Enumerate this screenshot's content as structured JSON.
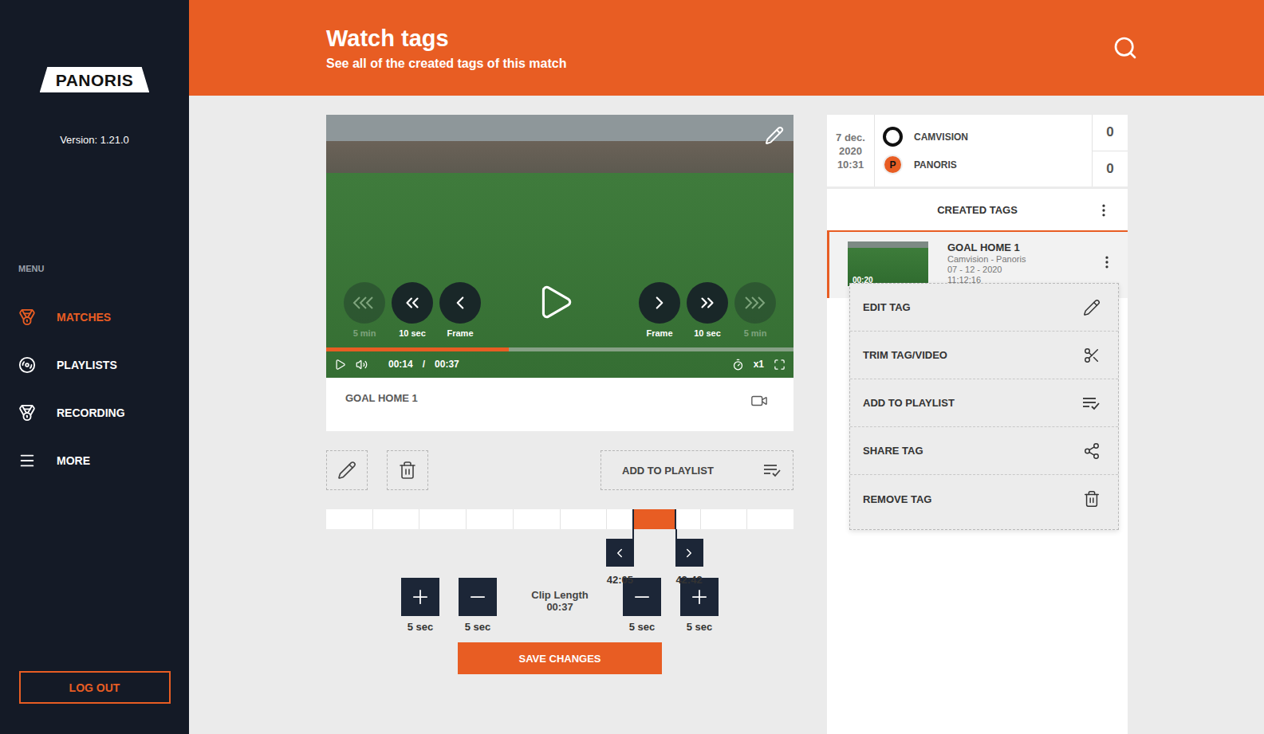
{
  "sidebar": {
    "logo": "PANORIS",
    "version": "Version: 1.21.0",
    "menu_label": "MENU",
    "items": [
      {
        "label": "MATCHES",
        "icon": "matches",
        "selected": true
      },
      {
        "label": "PLAYLISTS",
        "icon": "playlists",
        "selected": false
      },
      {
        "label": "RECORDING",
        "icon": "recording",
        "selected": false
      },
      {
        "label": "MORE",
        "icon": "more",
        "selected": false
      }
    ],
    "logout": "LOG OUT"
  },
  "header": {
    "title": "Watch tags",
    "subtitle": "See all of the created tags of this match"
  },
  "player": {
    "buttons_back": [
      {
        "label": "5 min",
        "kind": "triple",
        "disabled": true
      },
      {
        "label": "10 sec",
        "kind": "double",
        "disabled": false
      },
      {
        "label": "Frame",
        "kind": "single",
        "disabled": false
      }
    ],
    "buttons_forward": [
      {
        "label": "Frame",
        "kind": "single",
        "disabled": false
      },
      {
        "label": "10 sec",
        "kind": "double",
        "disabled": false
      },
      {
        "label": "5 min",
        "kind": "triple",
        "disabled": true
      }
    ],
    "level": 0.39,
    "current_time": "00:14",
    "separator": "/",
    "duration": "00:37",
    "speed": "x1"
  },
  "tag_title": "GOAL HOME 1",
  "actions": {
    "add_to_playlist": "ADD TO PLAYLIST"
  },
  "timeline": {
    "selection_start_level": 0.655,
    "selection_end_level": 0.75,
    "start_time": "42:05",
    "end_time": "42:42"
  },
  "clip": {
    "label": "Clip Length",
    "value": "00:37",
    "start_controls": [
      {
        "kind": "plus",
        "label": "5 sec"
      },
      {
        "kind": "minus",
        "label": "5 sec"
      }
    ],
    "end_controls": [
      {
        "kind": "minus",
        "label": "5 sec"
      },
      {
        "kind": "plus",
        "label": "5 sec"
      }
    ]
  },
  "save": "SAVE CHANGES",
  "match": {
    "date": [
      "7 dec.",
      "2020",
      "10:31"
    ],
    "teams": [
      {
        "name": "CAMVISION",
        "score": "0",
        "badge": "",
        "kind": "ring"
      },
      {
        "name": "PANORIS",
        "score": "0",
        "badge": "P",
        "kind": "disc"
      }
    ]
  },
  "tags_panel": {
    "title": "CREATED TAGS",
    "items": [
      {
        "title": "GOAL HOME 1",
        "match": "Camvision - Panoris",
        "date": "07 - 12 - 2020",
        "time": "11:12:16",
        "duration": "00:20",
        "selected": true
      }
    ]
  },
  "context_menu": {
    "items": [
      {
        "label": "EDIT TAG",
        "icon": "edit"
      },
      {
        "label": "TRIM TAG/VIDEO",
        "icon": "trim"
      },
      {
        "label": "ADD TO PLAYLIST",
        "icon": "playlist"
      },
      {
        "label": "SHARE TAG",
        "icon": "share"
      },
      {
        "label": "REMOVE TAG",
        "icon": "remove"
      }
    ]
  }
}
